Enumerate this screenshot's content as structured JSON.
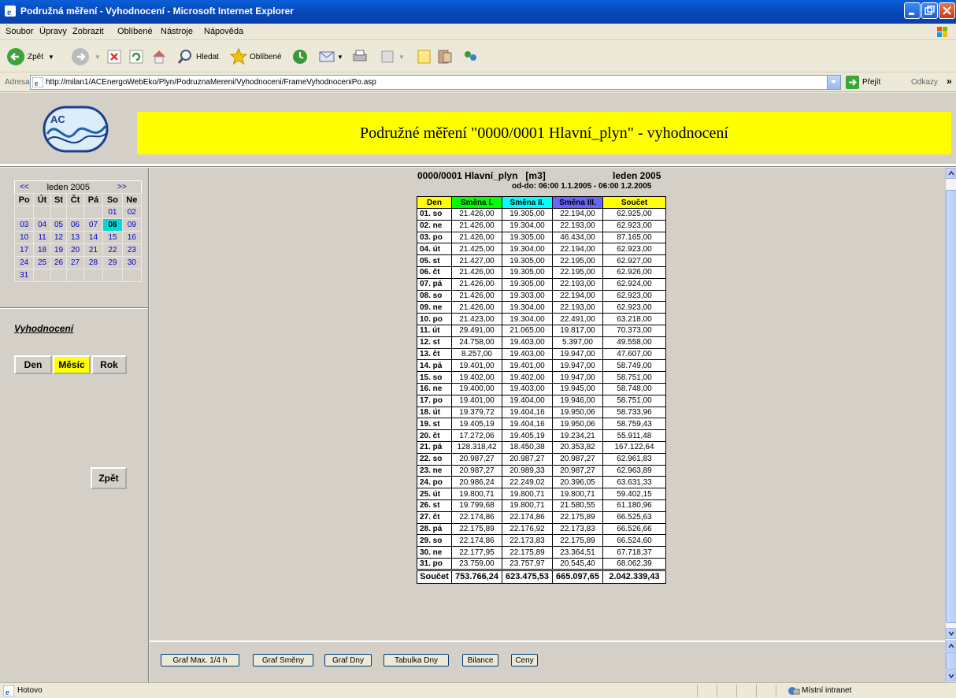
{
  "window": {
    "title": "Podružná měření - Vyhodnocení - Microsoft Internet Explorer"
  },
  "menu": [
    "Soubor",
    "Úpravy",
    "Zobrazit",
    "Oblíbené",
    "Nástroje",
    "Nápověda"
  ],
  "toolbar": {
    "back_label": "Zpět",
    "search_label": "Hledat",
    "favorites_label": "Oblíbené"
  },
  "address": {
    "label": "Adresa",
    "url": "http://milan1/ACEnergoWebEko/Plyn/PodruznaMereni/Vyhodnoceni/FrameVyhodnoceniPo.asp",
    "go_label": "Přejít",
    "links_label": "Odkazy"
  },
  "header": {
    "banner": "Podružné měření \"0000/0001 Hlavní_plyn\" - vyhodnocení",
    "logo_text": "AC"
  },
  "calendar": {
    "prev": "<<",
    "next": ">>",
    "month_label": "leden 2005",
    "weekdays": [
      "Po",
      "Út",
      "St",
      "Čt",
      "Pá",
      "So",
      "Ne"
    ],
    "weeks": [
      [
        "",
        "",
        "",
        "",
        "",
        "01",
        "02"
      ],
      [
        "03",
        "04",
        "05",
        "06",
        "07",
        "08",
        "09"
      ],
      [
        "10",
        "11",
        "12",
        "13",
        "14",
        "15",
        "16"
      ],
      [
        "17",
        "18",
        "19",
        "20",
        "21",
        "22",
        "23"
      ],
      [
        "24",
        "25",
        "26",
        "27",
        "28",
        "29",
        "30"
      ],
      [
        "31",
        "",
        "",
        "",
        "",
        "",
        ""
      ]
    ],
    "today": "08"
  },
  "left": {
    "section_label": "Vyhodnocení",
    "buttons": [
      "Den",
      "Měsíc",
      "Rok"
    ],
    "back_button": "Zpět"
  },
  "report": {
    "meter": "0000/0001 Hlavní_plyn",
    "unit": "[m3]",
    "month": "leden 2005",
    "range": "od-do: 06:00 1.1.2005  -  06:00 1.2.2005",
    "columns": [
      "Den",
      "Směna I.",
      "Směna II.",
      "Směna III.",
      "Součet"
    ],
    "column_colors": [
      "#ffff00",
      "#00ff00",
      "#00ffff",
      "#6666ff",
      "#ffff00"
    ],
    "rows": [
      [
        "01. so",
        "21.426,00",
        "19.305,00",
        "22.194,00",
        "62.925,00"
      ],
      [
        "02. ne",
        "21.426,00",
        "19.304,00",
        "22.193,00",
        "62.923,00"
      ],
      [
        "03. po",
        "21.426,00",
        "19.305,00",
        "46.434,00",
        "87.165,00"
      ],
      [
        "04. út",
        "21.425,00",
        "19.304,00",
        "22.194,00",
        "62.923,00"
      ],
      [
        "05. st",
        "21.427,00",
        "19.305,00",
        "22.195,00",
        "62.927,00"
      ],
      [
        "06. čt",
        "21.426,00",
        "19.305,00",
        "22.195,00",
        "62.926,00"
      ],
      [
        "07. pá",
        "21.426,00",
        "19.305,00",
        "22.193,00",
        "62.924,00"
      ],
      [
        "08. so",
        "21.426,00",
        "19.303,00",
        "22.194,00",
        "62.923,00"
      ],
      [
        "09. ne",
        "21.426,00",
        "19.304,00",
        "22.193,00",
        "62.923,00"
      ],
      [
        "10. po",
        "21.423,00",
        "19.304,00",
        "22.491,00",
        "63.218,00"
      ],
      [
        "11. út",
        "29.491,00",
        "21.065,00",
        "19.817,00",
        "70.373,00"
      ],
      [
        "12. st",
        "24.758,00",
        "19.403,00",
        "5.397,00",
        "49.558,00"
      ],
      [
        "13. čt",
        "8.257,00",
        "19.403,00",
        "19.947,00",
        "47.607,00"
      ],
      [
        "14. pá",
        "19.401,00",
        "19.401,00",
        "19.947,00",
        "58.749,00"
      ],
      [
        "15. so",
        "19.402,00",
        "19.402,00",
        "19.947,00",
        "58.751,00"
      ],
      [
        "16. ne",
        "19.400,00",
        "19.403,00",
        "19.945,00",
        "58.748,00"
      ],
      [
        "17. po",
        "19.401,00",
        "19.404,00",
        "19.946,00",
        "58.751,00"
      ],
      [
        "18. út",
        "19.379,72",
        "19.404,16",
        "19.950,06",
        "58.733,96"
      ],
      [
        "19. st",
        "19.405,19",
        "19.404,16",
        "19.950,06",
        "58.759,43"
      ],
      [
        "20. čt",
        "17.272,06",
        "19.405,19",
        "19.234,21",
        "55.911,48"
      ],
      [
        "21. pá",
        "128.318,42",
        "18.450,38",
        "20.353,82",
        "167.122,64"
      ],
      [
        "22. so",
        "20.987,27",
        "20.987,27",
        "20.987,27",
        "62.961,83"
      ],
      [
        "23. ne",
        "20.987,27",
        "20.989,33",
        "20.987,27",
        "62.963,89"
      ],
      [
        "24. po",
        "20.986,24",
        "22.249,02",
        "20.396,05",
        "63.631,33"
      ],
      [
        "25. út",
        "19.800,71",
        "19.800,71",
        "19.800,71",
        "59.402,15"
      ],
      [
        "26. st",
        "19.799,68",
        "19.800,71",
        "21.580,55",
        "61.180,96"
      ],
      [
        "27. čt",
        "22.174,86",
        "22.174,86",
        "22.175,89",
        "66.525,63"
      ],
      [
        "28. pá",
        "22.175,89",
        "22.176,92",
        "22.173,83",
        "66.526,66"
      ],
      [
        "29. so",
        "22.174,86",
        "22.173,83",
        "22.175,89",
        "66.524,60"
      ],
      [
        "30. ne",
        "22.177,95",
        "22.175,89",
        "23.364,51",
        "67.718,37"
      ],
      [
        "31. po",
        "23.759,00",
        "23.757,97",
        "20.545,40",
        "68.062,39"
      ]
    ],
    "total": [
      "Součet",
      "753.766,24",
      "623.475,53",
      "665.097,65",
      "2.042.339,43"
    ]
  },
  "bottom_buttons": [
    "Graf Max. 1/4 h",
    "Graf Směny",
    "Graf Dny",
    "Tabulka Dny",
    "Bilance",
    "Ceny"
  ],
  "status": {
    "text": "Hotovo",
    "zone": "Místní intranet"
  }
}
